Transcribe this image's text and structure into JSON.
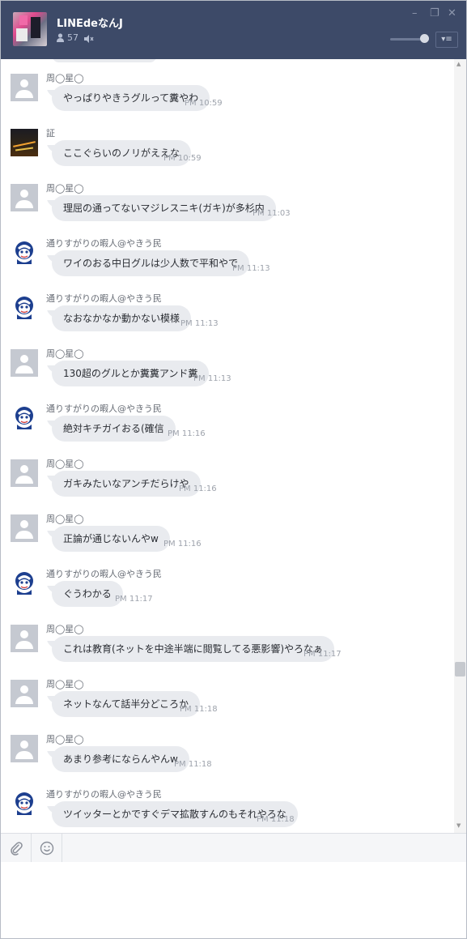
{
  "window": {
    "title": "LINEdeなんJ",
    "member_count": "57",
    "controls": [
      "–",
      "❐",
      "✕"
    ],
    "volume_level": 0.78
  },
  "messages": [
    {
      "sender": "周◯星◯",
      "avatar": "default",
      "text": "やっぱりやきうグルって糞やわ",
      "time": "PM 10:59"
    },
    {
      "sender": "証",
      "avatar": "night",
      "text": "ここぐらいのノリがええな",
      "time": "PM 10:59"
    },
    {
      "sender": "周◯星◯",
      "avatar": "default",
      "text": "理屈の通ってないマジレスニキ(ガキ)が多杉内",
      "time": "PM 11:03"
    },
    {
      "sender": "通りすがりの暇人@やきう民",
      "avatar": "mascot",
      "text": "ワイのおる中日グルは少人数で平和やで",
      "time": "PM 11:13"
    },
    {
      "sender": "通りすがりの暇人@やきう民",
      "avatar": "mascot",
      "text": "なおなかなか動かない模様",
      "time": "PM 11:13"
    },
    {
      "sender": "周◯星◯",
      "avatar": "default",
      "text": "130超のグルとか糞糞アンド糞",
      "time": "PM 11:13"
    },
    {
      "sender": "通りすがりの暇人@やきう民",
      "avatar": "mascot",
      "text": "絶対キチガイおる(確信",
      "time": "PM 11:16"
    },
    {
      "sender": "周◯星◯",
      "avatar": "default",
      "text": "ガキみたいなアンチだらけや",
      "time": "PM 11:16"
    },
    {
      "sender": "周◯星◯",
      "avatar": "default",
      "text": "正論が通じないんやw",
      "time": "PM 11:16"
    },
    {
      "sender": "通りすがりの暇人@やきう民",
      "avatar": "mascot",
      "text": "ぐうわかる",
      "time": "PM 11:17"
    },
    {
      "sender": "周◯星◯",
      "avatar": "default",
      "text": "これは教育(ネットを中途半端に閲覧してる悪影響)やろなぁ",
      "time": "PM 11:17"
    },
    {
      "sender": "周◯星◯",
      "avatar": "default",
      "text": "ネットなんて話半分どころか",
      "time": "PM 11:18"
    },
    {
      "sender": "周◯星◯",
      "avatar": "default",
      "text": "あまり参考にならんやんw",
      "time": "PM 11:18"
    },
    {
      "sender": "通りすがりの暇人@やきう民",
      "avatar": "mascot",
      "text": "ツイッターとかですぐデマ拡散すんのもそれやろな",
      "time": "PM 11:18"
    }
  ],
  "colors": {
    "titlebar": "#3d4a68",
    "bubble": "#e9ebef",
    "time_text": "#9ea3ac"
  },
  "icons": {
    "members": "person-icon",
    "mute": "speaker-muted-icon",
    "attach": "paperclip-icon",
    "emoji": "smiley-icon",
    "menu": "menu-icon"
  }
}
